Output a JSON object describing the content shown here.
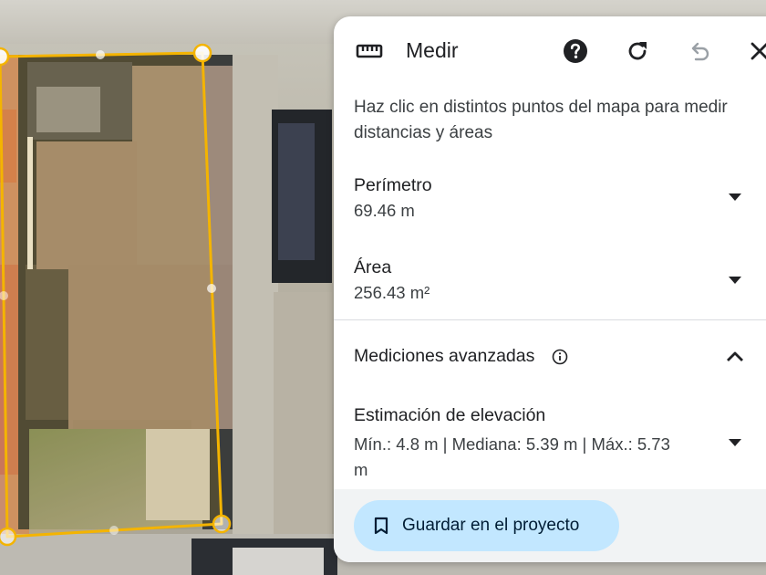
{
  "panel": {
    "title": "Medir",
    "description": "Haz clic en distintos puntos del mapa para medir distancias y áreas",
    "perimeter": {
      "label": "Perímetro",
      "value": "69.46 m"
    },
    "area": {
      "label": "Área",
      "value": "256.43 m²"
    },
    "advanced": {
      "label": "Mediciones avanzadas"
    },
    "elevation": {
      "label": "Estimación de elevación",
      "value": "Mín.: 4.8 m | Mediana: 5.39 m | Máx.: 5.73 m"
    },
    "save_button": "Guardar en el proyecto"
  },
  "icons": {
    "ruler": "ruler-icon",
    "help": "help-icon",
    "refresh": "refresh-icon",
    "undo": "undo-icon",
    "close": "close-icon",
    "info": "info-icon",
    "expand": "chevron-down-icon",
    "collapse": "chevron-up-icon",
    "bookmark": "bookmark-icon"
  },
  "colors": {
    "measure_line": "#f4b400",
    "save_button_bg": "#c2e7ff",
    "footer_bg": "#f1f3f4",
    "panel_bg": "#ffffff"
  }
}
